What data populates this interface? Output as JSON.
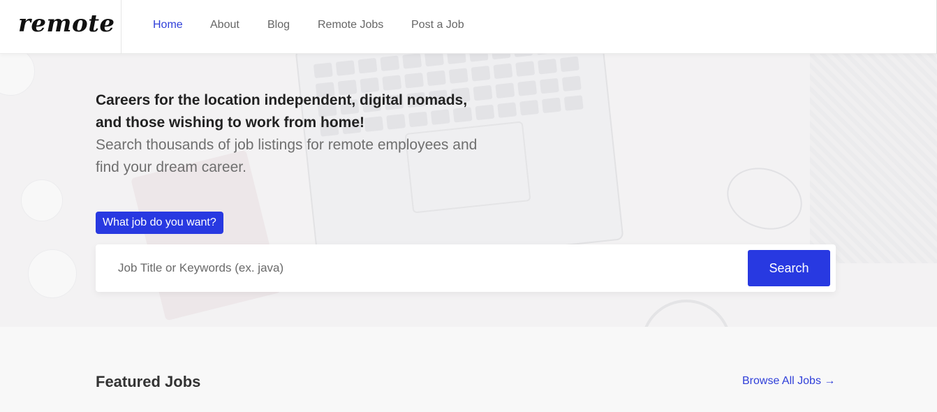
{
  "brand": {
    "logo": "remote"
  },
  "nav": {
    "items": [
      {
        "label": "Home",
        "active": true
      },
      {
        "label": "About"
      },
      {
        "label": "Blog"
      },
      {
        "label": "Remote Jobs"
      },
      {
        "label": "Post a Job"
      }
    ]
  },
  "hero": {
    "headline_line1": "Careers for the location independent, digital nomads,",
    "headline_line2": "and those wishing to work from home!",
    "subline_line1": "Search thousands of job listings for remote employees and",
    "subline_line2": "find your dream career.",
    "prompt_label": "What job do you want?",
    "search": {
      "placeholder": "Job Title or Keywords (ex. java)",
      "value": "",
      "button_label": "Search"
    }
  },
  "featured": {
    "title": "Featured Jobs",
    "browse_label": "Browse All Jobs →"
  },
  "colors": {
    "accent": "#2839e1",
    "link": "#2f3fd9",
    "text": "#333333",
    "muted": "#6f6f6f"
  }
}
